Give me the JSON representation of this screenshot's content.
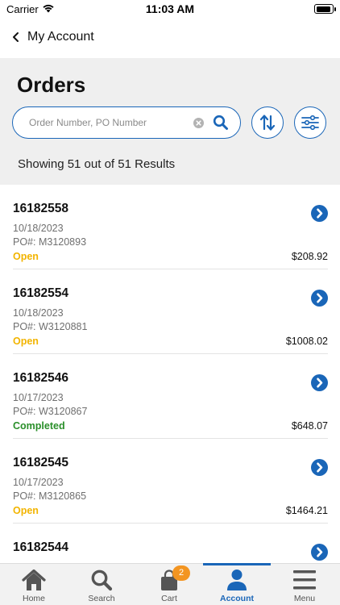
{
  "status_bar": {
    "carrier": "Carrier",
    "time": "11:03 AM"
  },
  "nav": {
    "back_label": "My Account"
  },
  "page": {
    "title": "Orders",
    "search": {
      "placeholder": "Order Number, PO Number",
      "value": ""
    },
    "results": "Showing 51 out of 51 Results"
  },
  "colors": {
    "accent": "#1a66b8",
    "open": "#f2b400",
    "completed": "#2a8f2a",
    "badge": "#f39521"
  },
  "orders": [
    {
      "number": "16182558",
      "date": "10/18/2023",
      "po": "PO#: M3120893",
      "status": "Open",
      "status_color": "#f2b400",
      "total": "$208.92"
    },
    {
      "number": "16182554",
      "date": "10/18/2023",
      "po": "PO#: W3120881",
      "status": "Open",
      "status_color": "#f2b400",
      "total": "$1008.02"
    },
    {
      "number": "16182546",
      "date": "10/17/2023",
      "po": "PO#: W3120867",
      "status": "Completed",
      "status_color": "#2a8f2a",
      "total": "$648.07"
    },
    {
      "number": "16182545",
      "date": "10/17/2023",
      "po": "PO#: M3120865",
      "status": "Open",
      "status_color": "#f2b400",
      "total": "$1464.21"
    },
    {
      "number": "16182544",
      "date": "",
      "po": "",
      "status": "",
      "status_color": "#f2b400",
      "total": ""
    }
  ],
  "tabs": [
    {
      "label": "Home",
      "icon": "home-icon"
    },
    {
      "label": "Search",
      "icon": "search-icon"
    },
    {
      "label": "Cart",
      "icon": "cart-icon",
      "badge": "2"
    },
    {
      "label": "Account",
      "icon": "account-icon",
      "active": true
    },
    {
      "label": "Menu",
      "icon": "menu-icon"
    }
  ]
}
